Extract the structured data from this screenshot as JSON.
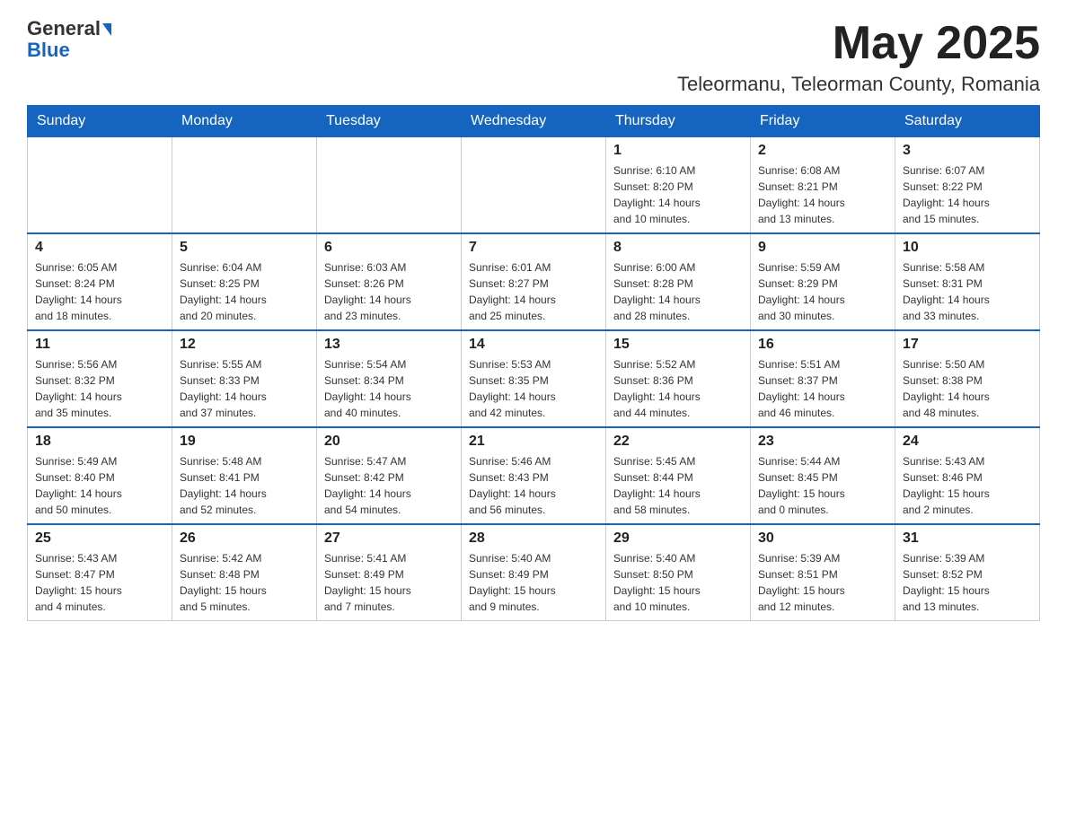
{
  "header": {
    "logo_line1": "General",
    "logo_line2": "Blue",
    "month_title": "May 2025",
    "location": "Teleormanu, Teleorman County, Romania"
  },
  "weekdays": [
    "Sunday",
    "Monday",
    "Tuesday",
    "Wednesday",
    "Thursday",
    "Friday",
    "Saturday"
  ],
  "weeks": [
    [
      {
        "day": "",
        "info": ""
      },
      {
        "day": "",
        "info": ""
      },
      {
        "day": "",
        "info": ""
      },
      {
        "day": "",
        "info": ""
      },
      {
        "day": "1",
        "info": "Sunrise: 6:10 AM\nSunset: 8:20 PM\nDaylight: 14 hours\nand 10 minutes."
      },
      {
        "day": "2",
        "info": "Sunrise: 6:08 AM\nSunset: 8:21 PM\nDaylight: 14 hours\nand 13 minutes."
      },
      {
        "day": "3",
        "info": "Sunrise: 6:07 AM\nSunset: 8:22 PM\nDaylight: 14 hours\nand 15 minutes."
      }
    ],
    [
      {
        "day": "4",
        "info": "Sunrise: 6:05 AM\nSunset: 8:24 PM\nDaylight: 14 hours\nand 18 minutes."
      },
      {
        "day": "5",
        "info": "Sunrise: 6:04 AM\nSunset: 8:25 PM\nDaylight: 14 hours\nand 20 minutes."
      },
      {
        "day": "6",
        "info": "Sunrise: 6:03 AM\nSunset: 8:26 PM\nDaylight: 14 hours\nand 23 minutes."
      },
      {
        "day": "7",
        "info": "Sunrise: 6:01 AM\nSunset: 8:27 PM\nDaylight: 14 hours\nand 25 minutes."
      },
      {
        "day": "8",
        "info": "Sunrise: 6:00 AM\nSunset: 8:28 PM\nDaylight: 14 hours\nand 28 minutes."
      },
      {
        "day": "9",
        "info": "Sunrise: 5:59 AM\nSunset: 8:29 PM\nDaylight: 14 hours\nand 30 minutes."
      },
      {
        "day": "10",
        "info": "Sunrise: 5:58 AM\nSunset: 8:31 PM\nDaylight: 14 hours\nand 33 minutes."
      }
    ],
    [
      {
        "day": "11",
        "info": "Sunrise: 5:56 AM\nSunset: 8:32 PM\nDaylight: 14 hours\nand 35 minutes."
      },
      {
        "day": "12",
        "info": "Sunrise: 5:55 AM\nSunset: 8:33 PM\nDaylight: 14 hours\nand 37 minutes."
      },
      {
        "day": "13",
        "info": "Sunrise: 5:54 AM\nSunset: 8:34 PM\nDaylight: 14 hours\nand 40 minutes."
      },
      {
        "day": "14",
        "info": "Sunrise: 5:53 AM\nSunset: 8:35 PM\nDaylight: 14 hours\nand 42 minutes."
      },
      {
        "day": "15",
        "info": "Sunrise: 5:52 AM\nSunset: 8:36 PM\nDaylight: 14 hours\nand 44 minutes."
      },
      {
        "day": "16",
        "info": "Sunrise: 5:51 AM\nSunset: 8:37 PM\nDaylight: 14 hours\nand 46 minutes."
      },
      {
        "day": "17",
        "info": "Sunrise: 5:50 AM\nSunset: 8:38 PM\nDaylight: 14 hours\nand 48 minutes."
      }
    ],
    [
      {
        "day": "18",
        "info": "Sunrise: 5:49 AM\nSunset: 8:40 PM\nDaylight: 14 hours\nand 50 minutes."
      },
      {
        "day": "19",
        "info": "Sunrise: 5:48 AM\nSunset: 8:41 PM\nDaylight: 14 hours\nand 52 minutes."
      },
      {
        "day": "20",
        "info": "Sunrise: 5:47 AM\nSunset: 8:42 PM\nDaylight: 14 hours\nand 54 minutes."
      },
      {
        "day": "21",
        "info": "Sunrise: 5:46 AM\nSunset: 8:43 PM\nDaylight: 14 hours\nand 56 minutes."
      },
      {
        "day": "22",
        "info": "Sunrise: 5:45 AM\nSunset: 8:44 PM\nDaylight: 14 hours\nand 58 minutes."
      },
      {
        "day": "23",
        "info": "Sunrise: 5:44 AM\nSunset: 8:45 PM\nDaylight: 15 hours\nand 0 minutes."
      },
      {
        "day": "24",
        "info": "Sunrise: 5:43 AM\nSunset: 8:46 PM\nDaylight: 15 hours\nand 2 minutes."
      }
    ],
    [
      {
        "day": "25",
        "info": "Sunrise: 5:43 AM\nSunset: 8:47 PM\nDaylight: 15 hours\nand 4 minutes."
      },
      {
        "day": "26",
        "info": "Sunrise: 5:42 AM\nSunset: 8:48 PM\nDaylight: 15 hours\nand 5 minutes."
      },
      {
        "day": "27",
        "info": "Sunrise: 5:41 AM\nSunset: 8:49 PM\nDaylight: 15 hours\nand 7 minutes."
      },
      {
        "day": "28",
        "info": "Sunrise: 5:40 AM\nSunset: 8:49 PM\nDaylight: 15 hours\nand 9 minutes."
      },
      {
        "day": "29",
        "info": "Sunrise: 5:40 AM\nSunset: 8:50 PM\nDaylight: 15 hours\nand 10 minutes."
      },
      {
        "day": "30",
        "info": "Sunrise: 5:39 AM\nSunset: 8:51 PM\nDaylight: 15 hours\nand 12 minutes."
      },
      {
        "day": "31",
        "info": "Sunrise: 5:39 AM\nSunset: 8:52 PM\nDaylight: 15 hours\nand 13 minutes."
      }
    ]
  ]
}
